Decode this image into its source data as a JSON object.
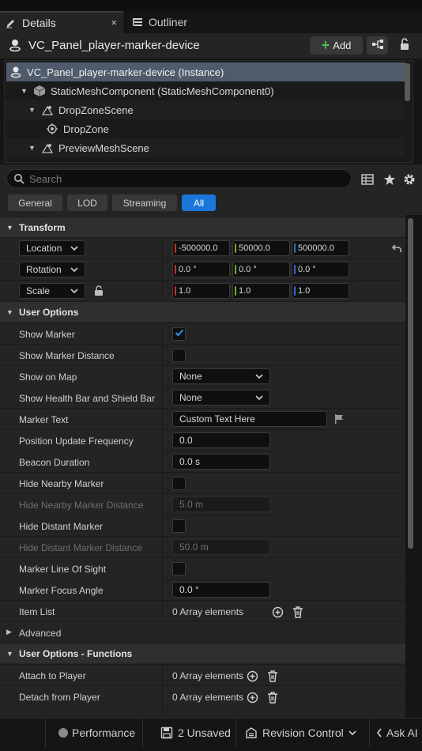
{
  "tabs": {
    "details": "Details",
    "outliner": "Outliner",
    "close_glyph": "×"
  },
  "header": {
    "title": "VC_Panel_player-marker-device",
    "add_label": "Add"
  },
  "tree": [
    {
      "label": "VC_Panel_player-marker-device (Instance)",
      "icon": "actor-icon"
    },
    {
      "label": "StaticMeshComponent (StaticMeshComponent0)",
      "icon": "static-mesh-icon"
    },
    {
      "label": "DropZoneScene",
      "icon": "scene-component-icon"
    },
    {
      "label": "DropZone",
      "icon": "drop-zone-icon"
    },
    {
      "label": "PreviewMeshScene",
      "icon": "scene-component-icon"
    }
  ],
  "search": {
    "placeholder": "Search"
  },
  "filters": {
    "general": "General",
    "lod": "LOD",
    "streaming": "Streaming",
    "all": "All"
  },
  "transform": {
    "category": "Transform",
    "location": {
      "label": "Location",
      "x": "-500000.0",
      "y": "50000.0",
      "z": "500000.0"
    },
    "rotation": {
      "label": "Rotation",
      "x": "0.0 °",
      "y": "0.0 °",
      "z": "0.0 °"
    },
    "scale": {
      "label": "Scale",
      "x": "1.0",
      "y": "1.0",
      "z": "1.0"
    }
  },
  "user_options": {
    "category": "User Options",
    "show_marker": "Show Marker",
    "show_marker_distance": "Show Marker Distance",
    "show_on_map": {
      "label": "Show on Map",
      "value": "None"
    },
    "show_health": {
      "label": "Show Health Bar and Shield Bar",
      "value": "None"
    },
    "marker_text": {
      "label": "Marker Text",
      "value": "Custom Text Here"
    },
    "position_update": {
      "label": "Position Update Frequency",
      "value": "0.0"
    },
    "beacon_duration": {
      "label": "Beacon Duration",
      "value": "0.0 s"
    },
    "hide_nearby": "Hide Nearby Marker",
    "hide_nearby_distance": {
      "label": "Hide Nearby Marker Distance",
      "value": "5.0 m"
    },
    "hide_distant": "Hide Distant  Marker",
    "hide_distant_distance": {
      "label": "Hide Distant Marker Distance",
      "value": "50.0 m"
    },
    "line_of_sight": "Marker Line Of Sight",
    "focus_angle": {
      "label": "Marker Focus Angle",
      "value": "0.0 °"
    },
    "item_list": {
      "label": "Item List",
      "value": "0 Array elements"
    }
  },
  "advanced": "Advanced",
  "functions": {
    "category": "User Options - Functions",
    "attach": {
      "label": "Attach to Player",
      "value": "0 Array elements"
    },
    "detach": {
      "label": "Detach from Player",
      "value": "0 Array elements"
    }
  },
  "status": {
    "performance": "Performance",
    "unsaved": "2 Unsaved",
    "revision": "Revision Control",
    "ask_ai": "Ask AI"
  },
  "colors": {
    "x_axis": "#c8302a",
    "y_axis": "#6fae2a",
    "z_axis": "#2d6fd6",
    "accent": "#1a76d8",
    "checkmark": "#2f8fff"
  }
}
